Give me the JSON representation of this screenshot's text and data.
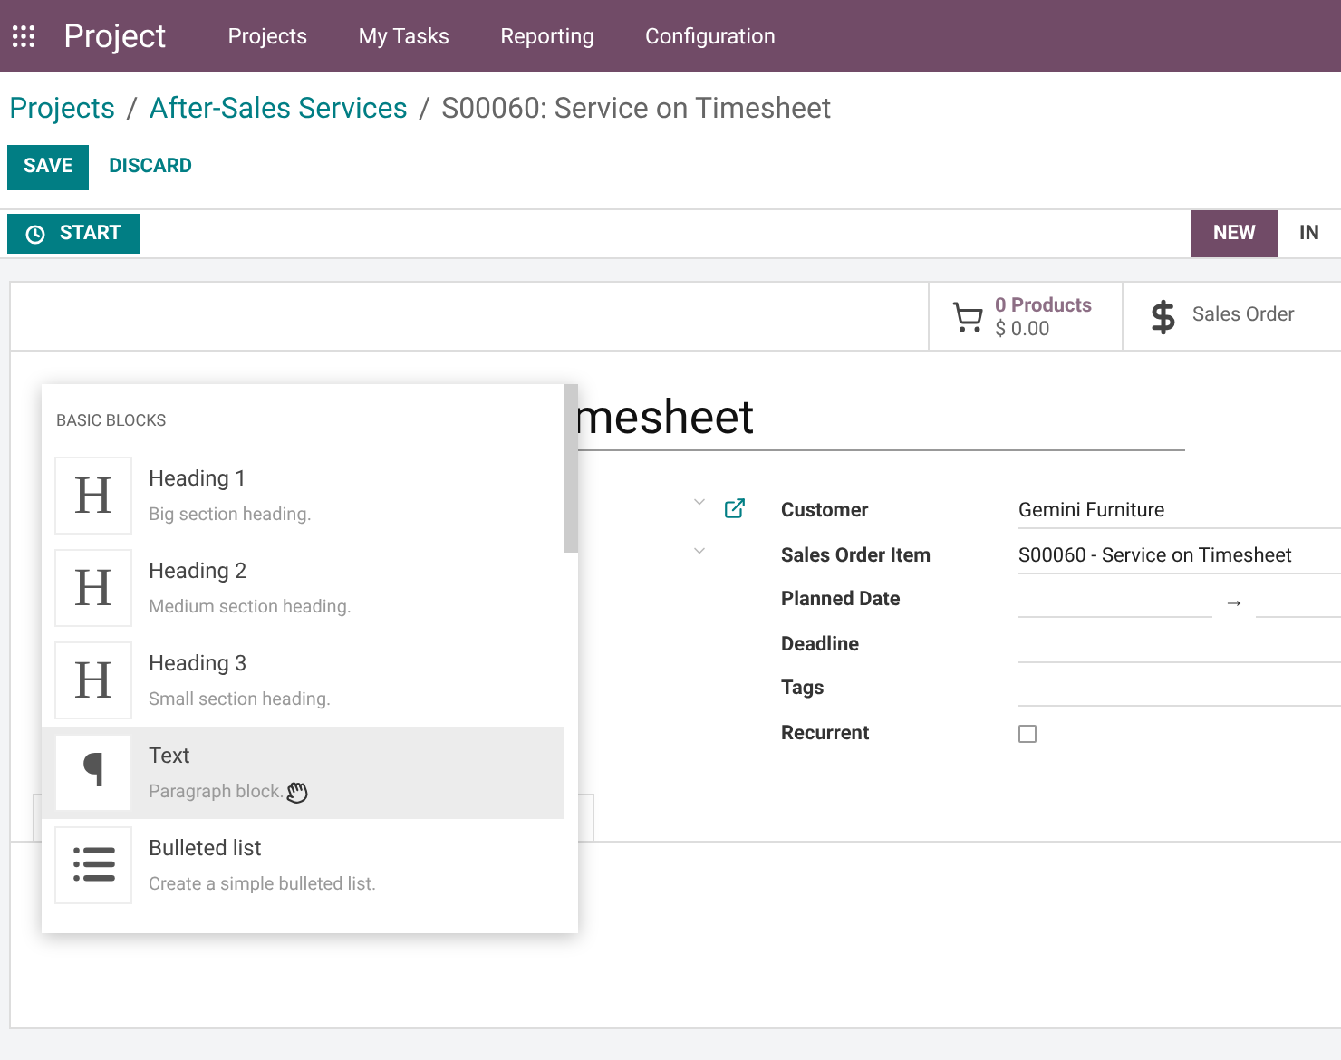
{
  "navbar": {
    "app": "Project",
    "menu": [
      "Projects",
      "My Tasks",
      "Reporting",
      "Configuration"
    ]
  },
  "breadcrumb": {
    "links": [
      "Projects",
      "After-Sales Services"
    ],
    "separator": "/",
    "current": "S00060: Service on Timesheet"
  },
  "actions": {
    "save": "SAVE",
    "discard": "DISCARD"
  },
  "statusbar": {
    "start": "START",
    "stages": [
      {
        "label": "NEW",
        "selected": true
      },
      {
        "label": "IN",
        "selected": false
      }
    ]
  },
  "button_box": [
    {
      "kind": "products",
      "title": "0 Products",
      "value": "$ 0.00"
    },
    {
      "kind": "sales",
      "title": "Sales Order"
    }
  ],
  "task_title": "mesheet",
  "fields": [
    {
      "label": "Customer",
      "value": "Gemini Furniture",
      "kind": "text"
    },
    {
      "label": "Sales Order Item",
      "value": "S00060 - Service on Timesheet",
      "kind": "text"
    },
    {
      "label": "Planned Date",
      "kind": "range",
      "arrow": "→"
    },
    {
      "label": "Deadline",
      "kind": "empty"
    },
    {
      "label": "Tags",
      "kind": "empty"
    },
    {
      "label": "Recurrent",
      "kind": "checkbox",
      "checked": false
    }
  ],
  "powerbox": {
    "category": "BASIC BLOCKS",
    "items": [
      {
        "kind": "heading",
        "glyph": "H",
        "title": "Heading 1",
        "description": "Big section heading.",
        "selected": false
      },
      {
        "kind": "heading",
        "glyph": "H",
        "title": "Heading 2",
        "description": "Medium section heading.",
        "selected": false
      },
      {
        "kind": "heading",
        "glyph": "H",
        "title": "Heading 3",
        "description": "Small section heading.",
        "selected": false
      },
      {
        "kind": "paragraph",
        "glyph": "¶",
        "title": "Text",
        "description": "Paragraph block.",
        "selected": true
      },
      {
        "kind": "list",
        "title": "Bulleted list",
        "description": "Create a simple bulleted list.",
        "selected": false
      }
    ]
  }
}
